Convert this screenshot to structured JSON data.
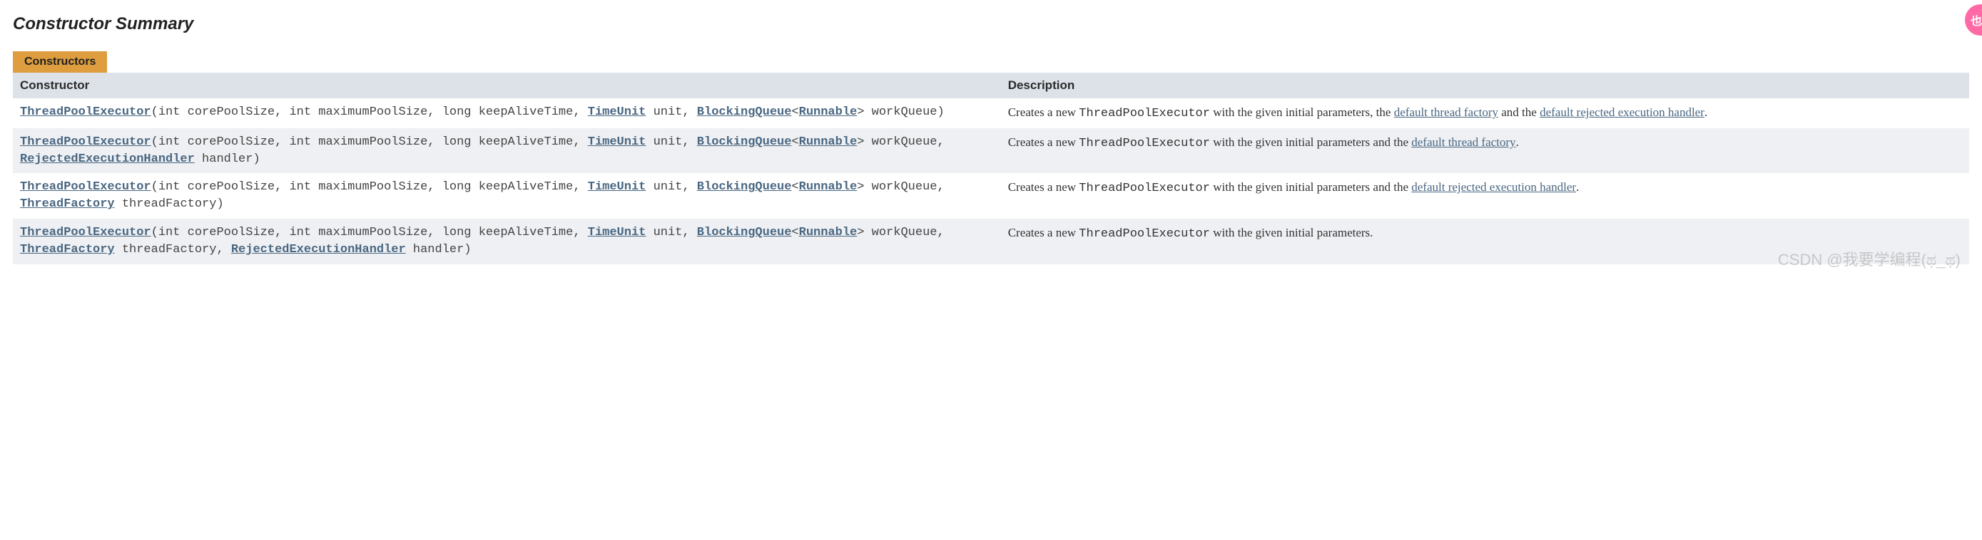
{
  "section_title": "Constructor Summary",
  "table_caption": "Constructors",
  "columns": [
    "Constructor",
    "Description"
  ],
  "rows": [
    {
      "sig": [
        {
          "t": "link",
          "v": "ThreadPoolExecutor"
        },
        {
          "t": "plain",
          "v": "(int corePoolSize, int maximumPoolSize, long keepAliveTime, "
        },
        {
          "t": "link",
          "v": "TimeUnit"
        },
        {
          "t": "plain",
          "v": " unit, "
        },
        {
          "t": "link",
          "v": "BlockingQueue"
        },
        {
          "t": "plain",
          "v": "<"
        },
        {
          "t": "link",
          "v": "Runnable"
        },
        {
          "t": "plain",
          "v": "> workQueue)"
        }
      ],
      "desc": [
        {
          "t": "plain",
          "v": "Creates a new "
        },
        {
          "t": "code",
          "v": "ThreadPoolExecutor"
        },
        {
          "t": "plain",
          "v": " with the given initial parameters, the "
        },
        {
          "t": "link",
          "v": "default thread factory"
        },
        {
          "t": "plain",
          "v": " and the "
        },
        {
          "t": "link",
          "v": "default rejected execution handler"
        },
        {
          "t": "plain",
          "v": "."
        }
      ]
    },
    {
      "sig": [
        {
          "t": "link",
          "v": "ThreadPoolExecutor"
        },
        {
          "t": "plain",
          "v": "(int corePoolSize, int maximumPoolSize, long keepAliveTime, "
        },
        {
          "t": "link",
          "v": "TimeUnit"
        },
        {
          "t": "plain",
          "v": " unit, "
        },
        {
          "t": "link",
          "v": "BlockingQueue"
        },
        {
          "t": "plain",
          "v": "<"
        },
        {
          "t": "link",
          "v": "Runnable"
        },
        {
          "t": "plain",
          "v": "> workQueue, "
        },
        {
          "t": "link",
          "v": "RejectedExecutionHandler"
        },
        {
          "t": "plain",
          "v": " handler)"
        }
      ],
      "desc": [
        {
          "t": "plain",
          "v": "Creates a new "
        },
        {
          "t": "code",
          "v": "ThreadPoolExecutor"
        },
        {
          "t": "plain",
          "v": " with the given initial parameters and the "
        },
        {
          "t": "link",
          "v": "default thread factory"
        },
        {
          "t": "plain",
          "v": "."
        }
      ]
    },
    {
      "sig": [
        {
          "t": "link",
          "v": "ThreadPoolExecutor"
        },
        {
          "t": "plain",
          "v": "(int corePoolSize, int maximumPoolSize, long keepAliveTime, "
        },
        {
          "t": "link",
          "v": "TimeUnit"
        },
        {
          "t": "plain",
          "v": " unit, "
        },
        {
          "t": "link",
          "v": "BlockingQueue"
        },
        {
          "t": "plain",
          "v": "<"
        },
        {
          "t": "link",
          "v": "Runnable"
        },
        {
          "t": "plain",
          "v": "> workQueue, "
        },
        {
          "t": "link",
          "v": "ThreadFactory"
        },
        {
          "t": "plain",
          "v": " threadFactory)"
        }
      ],
      "desc": [
        {
          "t": "plain",
          "v": "Creates a new "
        },
        {
          "t": "code",
          "v": "ThreadPoolExecutor"
        },
        {
          "t": "plain",
          "v": " with the given initial parameters and the "
        },
        {
          "t": "link",
          "v": "default rejected execution handler"
        },
        {
          "t": "plain",
          "v": "."
        }
      ]
    },
    {
      "sig": [
        {
          "t": "link",
          "v": "ThreadPoolExecutor"
        },
        {
          "t": "plain",
          "v": "(int corePoolSize, int maximumPoolSize, long keepAliveTime, "
        },
        {
          "t": "link",
          "v": "TimeUnit"
        },
        {
          "t": "plain",
          "v": " unit, "
        },
        {
          "t": "link",
          "v": "BlockingQueue"
        },
        {
          "t": "plain",
          "v": "<"
        },
        {
          "t": "link",
          "v": "Runnable"
        },
        {
          "t": "plain",
          "v": "> workQueue, "
        },
        {
          "t": "link",
          "v": "ThreadFactory"
        },
        {
          "t": "plain",
          "v": " threadFactory, "
        },
        {
          "t": "link",
          "v": "RejectedExecutionHandler"
        },
        {
          "t": "plain",
          "v": " handler)"
        }
      ],
      "desc": [
        {
          "t": "plain",
          "v": "Creates a new "
        },
        {
          "t": "code",
          "v": "ThreadPoolExecutor"
        },
        {
          "t": "plain",
          "v": " with the given initial parameters."
        }
      ]
    }
  ],
  "watermark": "CSDN @我要学编程(ಥ_ಥ)",
  "side_bubble": "也"
}
